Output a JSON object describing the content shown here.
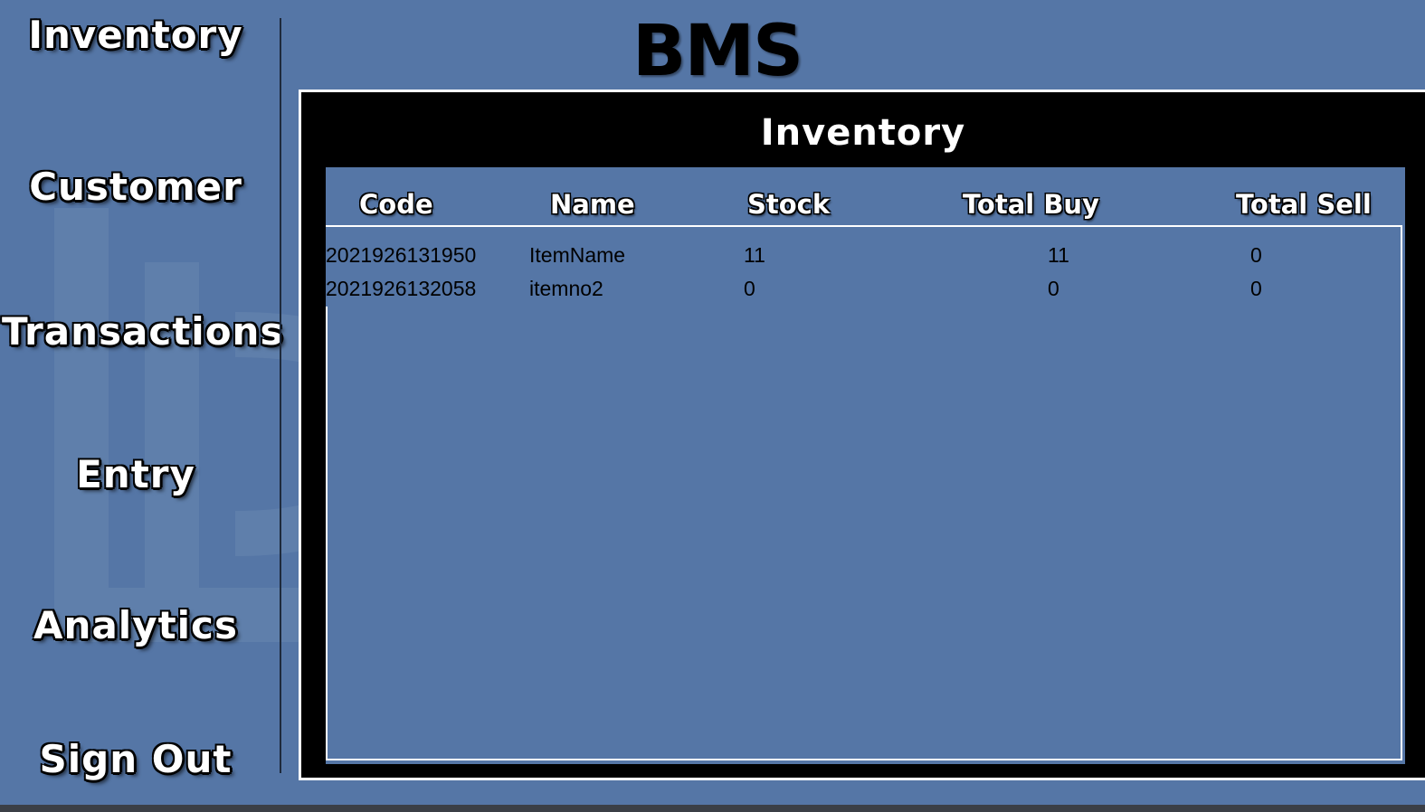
{
  "sidebar": {
    "items": [
      {
        "label": "Inventory"
      },
      {
        "label": "Customer"
      },
      {
        "label": "Transactions"
      },
      {
        "label": "Entry"
      },
      {
        "label": "Analytics"
      },
      {
        "label": "Sign Out"
      }
    ]
  },
  "header": {
    "logo_text": "BMS"
  },
  "panel": {
    "title": "Inventory",
    "columns": [
      "Code",
      "Name",
      "Stock",
      "Total Buy",
      "Total Sell"
    ],
    "rows": [
      {
        "code": "2021926131950",
        "name": "ItemName",
        "stock": "11",
        "total_buy": "11",
        "total_sell": "0"
      },
      {
        "code": "2021926132058",
        "name": "itemno2",
        "stock": "0",
        "total_buy": "0",
        "total_sell": "0"
      }
    ]
  },
  "colors": {
    "background": "#5576a6",
    "panel": "#000000",
    "text": "#ffffff"
  }
}
